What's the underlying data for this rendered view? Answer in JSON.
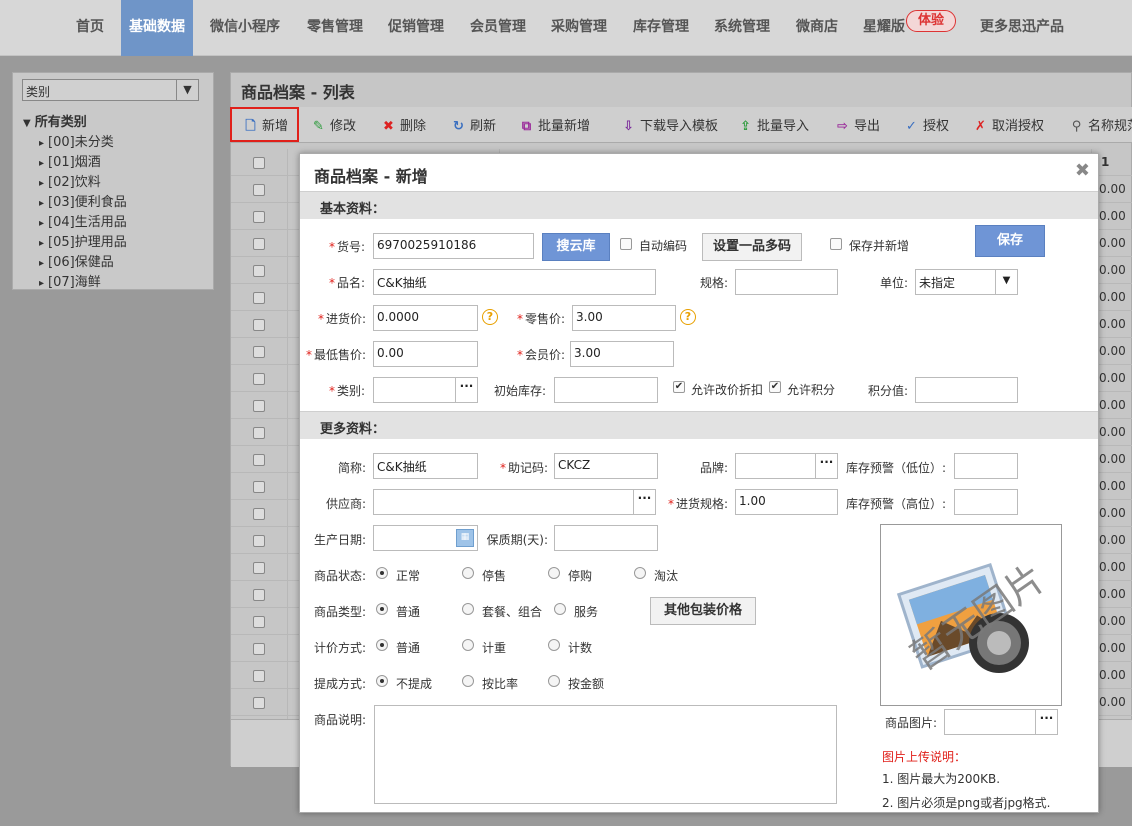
{
  "nav": {
    "items": [
      "首页",
      "基础数据",
      "微信小程序",
      "零售管理",
      "促销管理",
      "会员管理",
      "采购管理",
      "库存管理",
      "系统管理",
      "微商店",
      "星耀版",
      "更多思迅产品"
    ],
    "badge": "体验"
  },
  "sidebar": {
    "select_value": "类别",
    "root": "所有类别",
    "items": [
      "[00]未分类",
      "[01]烟酒",
      "[02]饮料",
      "[03]便利食品",
      "[04]生活用品",
      "[05]护理用品",
      "[06]保健品",
      "[07]海鲜"
    ]
  },
  "main": {
    "title": "商品档案 - 列表",
    "toolbar": [
      "新增",
      "修改",
      "删除",
      "刷新",
      "批量新增",
      "下载导入模板",
      "批量导入",
      "导出",
      "授权",
      "取消授权",
      "名称规范"
    ],
    "grid_header_right": "1",
    "grid_value": "0.00"
  },
  "modal": {
    "title": "商品档案 - 新增",
    "section_basic": "基本资料：",
    "section_more": "更多资料：",
    "labels": {
      "code": "货号:",
      "name": "品名:",
      "spec": "规格:",
      "unit": "单位:",
      "purchase_price": "进货价:",
      "retail_price": "零售价:",
      "min_price": "最低售价:",
      "member_price": "会员价:",
      "category": "类别:",
      "init_stock": "初始库存:",
      "points_value": "积分值:",
      "short_name": "简称:",
      "mnemonic": "助记码:",
      "brand": "品牌:",
      "stock_low": "库存预警（低位）:",
      "supplier": "供应商:",
      "purchase_spec": "进货规格:",
      "stock_high": "库存预警（高位）:",
      "prod_date": "生产日期:",
      "shelf_life": "保质期(天):",
      "status": "商品状态:",
      "type": "商品类型:",
      "pricing": "计价方式:",
      "commission": "提成方式:",
      "desc": "商品说明:",
      "image": "商品图片:"
    },
    "values": {
      "code": "6970025910186",
      "name": "C&K抽纸",
      "unit": "未指定",
      "purchase_price": "0.0000",
      "retail_price": "3.00",
      "min_price": "0.00",
      "member_price": "3.00",
      "short_name": "C&K抽纸",
      "mnemonic": "CKCZ",
      "purchase_spec": "1.00"
    },
    "buttons": {
      "search_cloud": "搜云库",
      "multi_code": "设置一品多码",
      "save": "保存",
      "other_pack": "其他包装价格"
    },
    "checkboxes": {
      "auto_code": "自动编码",
      "save_and_new": "保存并新增",
      "allow_price_discount": "允许改价折扣",
      "allow_points": "允许积分"
    },
    "status_options": [
      "正常",
      "停售",
      "停购",
      "淘汰"
    ],
    "type_options": [
      "普通",
      "套餐、组合",
      "服务"
    ],
    "pricing_options": [
      "普通",
      "计重",
      "计数"
    ],
    "commission_options": [
      "不提成",
      "按比率",
      "按金额"
    ],
    "image_placeholder": "暂无图片",
    "notes": {
      "title": "图片上传说明：",
      "line1": "1. 图片最大为200KB.",
      "line2": "2. 图片必须是png或者jpg格式."
    }
  }
}
